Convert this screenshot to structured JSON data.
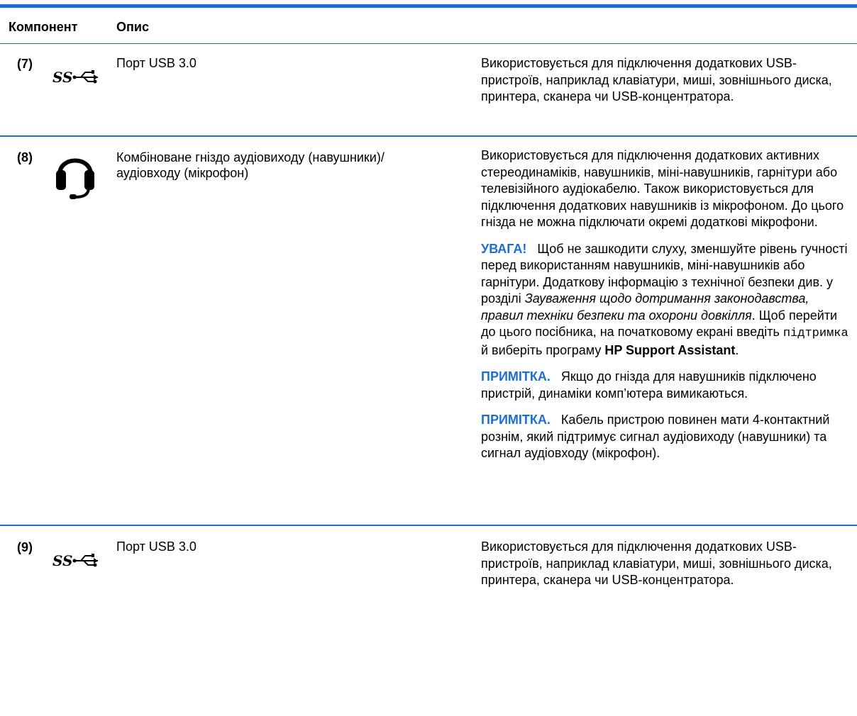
{
  "header": {
    "component": "Компонент",
    "description": "Опис"
  },
  "colors": {
    "accent": "#1b6fd1"
  },
  "rows": [
    {
      "number": "(7)",
      "icon": "usb-superspeed-icon",
      "name": "Порт USB 3.0",
      "description": "Використовується для підключення додаткових USB-пристроїв, наприклад клавіатури, миші, зовнішнього диска, принтера, сканера чи USB-концентратора."
    },
    {
      "number": "(8)",
      "icon": "headset-icon",
      "name": "Комбіноване гніздо аудіовиходу (навушники)/ аудіовходу (мікрофон)",
      "description": "Використовується для підключення додаткових активних стереодинаміків, навушників, міні-навушників, гарнітури або телевізійного аудіокабелю. Також використовується для підключення додаткових навушників із мікрофоном. До цього гнізда не можна підключати окремі додаткові мікрофони.",
      "warning": {
        "label": "УВАГА!",
        "text1": "Щоб не зашкодити слуху, зменшуйте рівень гучності перед використанням навушників, міні-навушників або гарнітури. Додаткову інформацію з технічної безпеки див. у розділі",
        "italic": "Зауваження щодо дотримання законодавства, правил техніки безпеки та охорони довкілля",
        "text2": ". Щоб перейти до цього посібника, на початковому екрані введіть",
        "mono": "підтримка",
        "text3": "й виберіть програму",
        "bold": "HP Support Assistant",
        "text4": "."
      },
      "note1": {
        "label": "ПРИМІТКА.",
        "text": "Якщо до гнізда для навушників підключено пристрій, динаміки комп’ютера вимикаються."
      },
      "note2": {
        "label": "ПРИМІТКА.",
        "text": "Кабель пристрою повинен мати 4-контактний рознім, який підтримує сигнал аудіовиходу (навушники) та сигнал аудіовходу (мікрофон)."
      }
    },
    {
      "number": "(9)",
      "icon": "usb-superspeed-icon",
      "name": "Порт USB 3.0",
      "description": "Використовується для підключення додаткових USB-пристроїв, наприклад клавіатури, миші, зовнішнього диска, принтера, сканера чи USB-концентратора."
    }
  ]
}
